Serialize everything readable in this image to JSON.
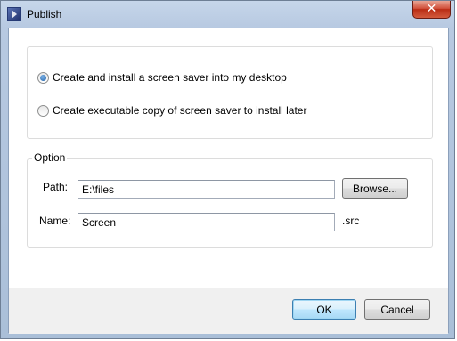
{
  "window": {
    "title": "Publish",
    "close_glyph": "✕"
  },
  "options": {
    "option_install": "Create and install a screen saver into my desktop",
    "option_executable": "Create executable copy of screen saver to install later",
    "selected": "option_install"
  },
  "option_group": {
    "legend": "Option",
    "path_label": "Path:",
    "path_value": "E:\\files",
    "browse_label": "Browse...",
    "name_label": "Name:",
    "name_value": "Screen",
    "extension": ".src"
  },
  "footer": {
    "ok_label": "OK",
    "cancel_label": "Cancel"
  },
  "colors": {
    "close_button": "#c9442b",
    "default_button_border": "#3c7fb1",
    "radio_dot": "#1c5fa8"
  },
  "icons": {
    "app": "publish-app-icon",
    "close": "close-icon"
  }
}
